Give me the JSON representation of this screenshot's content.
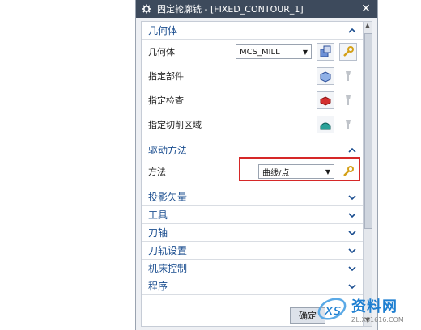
{
  "window": {
    "title": "固定轮廓铣 - [FIXED_CONTOUR_1]",
    "close": "✕"
  },
  "geometry": {
    "header": "几何体",
    "rows": [
      {
        "label": "几何体",
        "select_value": "MCS_MILL",
        "has_select": true
      },
      {
        "label": "指定部件"
      },
      {
        "label": "指定检查"
      },
      {
        "label": "指定切削区域"
      }
    ]
  },
  "drive": {
    "header": "驱动方法",
    "method_label": "方法",
    "method_value": "曲线/点"
  },
  "collapsed_sections": [
    "投影矢量",
    "工具",
    "刀轴",
    "刀轨设置",
    "机床控制",
    "程序"
  ],
  "footer": {
    "ok_label": "确定"
  },
  "watermark": {
    "text": "资料网",
    "url": "ZL.XS1616.COM"
  },
  "colors": {
    "title_bar": "#3d4a5c",
    "section_header": "#1a4d8f",
    "highlight": "#d62828"
  }
}
